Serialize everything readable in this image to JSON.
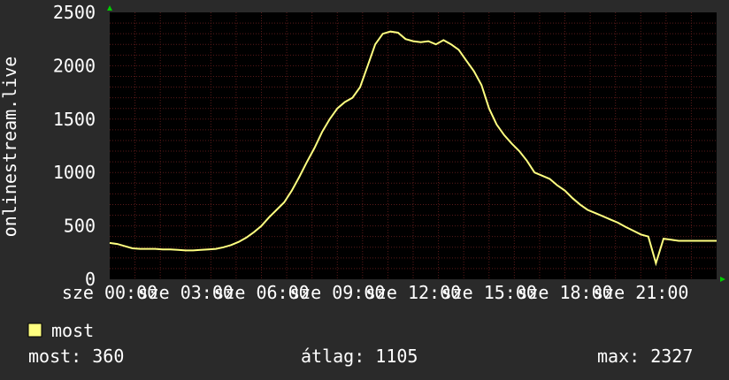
{
  "chart_data": {
    "type": "line",
    "ylabel": "onlinestream.live",
    "ylim": [
      0,
      2500
    ],
    "xlim": [
      0,
      24
    ],
    "grid": true,
    "y_ticks": [
      0,
      500,
      1000,
      1500,
      2000,
      2500
    ],
    "y_tick_labels": [
      "0",
      "500",
      "1000",
      "1500",
      "2000",
      "2500"
    ],
    "x_ticks": [
      0,
      3,
      6,
      9,
      12,
      15,
      18,
      21
    ],
    "x_tick_labels": [
      "sze 00:00",
      "sze 03:00",
      "sze 06:00",
      "sze 09:00",
      "sze 12:00",
      "sze 15:00",
      "sze 18:00",
      "sze 21:00"
    ],
    "colors": {
      "background": "#2a2a2a",
      "plot": "#000000",
      "grid": "#5a1a1a",
      "line": "#ffff80",
      "axis_arrow": "#00cc00"
    },
    "series": [
      {
        "name": "most",
        "x": [
          0,
          0.3,
          0.6,
          0.9,
          1.2,
          1.5,
          1.8,
          2.1,
          2.4,
          2.7,
          3.0,
          3.3,
          3.6,
          3.9,
          4.2,
          4.5,
          4.8,
          5.1,
          5.4,
          5.7,
          6.0,
          6.3,
          6.6,
          6.9,
          7.2,
          7.5,
          7.8,
          8.1,
          8.4,
          8.7,
          9.0,
          9.3,
          9.6,
          9.9,
          10.2,
          10.5,
          10.8,
          11.1,
          11.4,
          11.7,
          12.0,
          12.3,
          12.6,
          12.9,
          13.2,
          13.5,
          13.8,
          14.1,
          14.4,
          14.7,
          15.0,
          15.3,
          15.6,
          15.9,
          16.2,
          16.5,
          16.8,
          17.1,
          17.4,
          17.7,
          18.0,
          18.3,
          18.6,
          18.9,
          19.2,
          19.5,
          19.8,
          20.1,
          20.4,
          20.7,
          21.0,
          21.3,
          21.6,
          21.9,
          22.2,
          22.5,
          22.8,
          23.1,
          23.4,
          23.7,
          23.85,
          24.0
        ],
        "values": [
          340,
          330,
          310,
          290,
          285,
          285,
          285,
          280,
          280,
          275,
          270,
          270,
          275,
          280,
          285,
          300,
          320,
          350,
          390,
          440,
          500,
          580,
          650,
          720,
          830,
          960,
          1100,
          1230,
          1380,
          1500,
          1600,
          1660,
          1700,
          1800,
          2000,
          2200,
          2300,
          2320,
          2310,
          2250,
          2230,
          2220,
          2230,
          2200,
          2240,
          2200,
          2150,
          2050,
          1950,
          1820,
          1600,
          1450,
          1350,
          1270,
          1200,
          1110,
          1000,
          970,
          940,
          880,
          830,
          760,
          700,
          650,
          620,
          590,
          560,
          530,
          490,
          455,
          420,
          400,
          150,
          380,
          370,
          360,
          360,
          360,
          360,
          360,
          360,
          360
        ]
      }
    ]
  },
  "legend": {
    "label": "most",
    "swatch_color": "#ffff80"
  },
  "stats": {
    "current": "most: 360",
    "average": "átlag: 1105",
    "max": "max: 2327"
  }
}
